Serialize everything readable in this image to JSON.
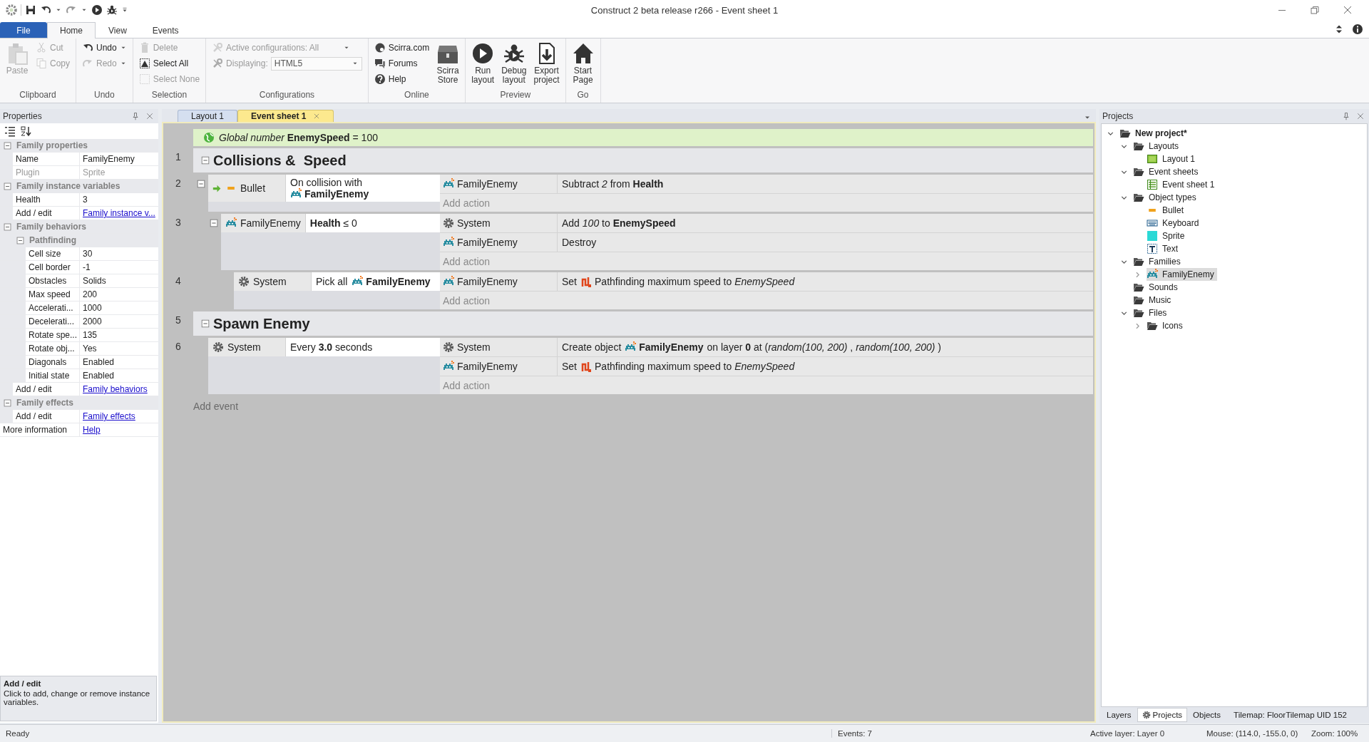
{
  "window": {
    "title": "Construct 2 beta release r266 - Event sheet 1"
  },
  "ribbon": {
    "tabs": [
      {
        "label": "File",
        "kind": "file",
        "selected": false
      },
      {
        "label": "Home",
        "kind": "tab",
        "selected": true
      },
      {
        "label": "View",
        "kind": "tab",
        "selected": false
      },
      {
        "label": "Events",
        "kind": "tab",
        "selected": false
      }
    ],
    "groups": [
      {
        "label": "Clipboard",
        "buttons": [
          {
            "label": "Paste",
            "kind": "large",
            "disabled": true
          },
          {
            "label": "Cut",
            "kind": "small",
            "disabled": true
          },
          {
            "label": "Copy",
            "kind": "small",
            "disabled": true
          }
        ]
      },
      {
        "label": "Undo",
        "buttons": [
          {
            "label": "Undo",
            "kind": "split",
            "disabled": false
          },
          {
            "label": "Redo",
            "kind": "split",
            "disabled": true
          }
        ]
      },
      {
        "label": "Selection",
        "buttons": [
          {
            "label": "Delete",
            "kind": "small",
            "disabled": true
          },
          {
            "label": "Select All",
            "kind": "small",
            "disabled": false
          },
          {
            "label": "Select None",
            "kind": "small",
            "disabled": true
          }
        ]
      },
      {
        "label": "Configurations",
        "buttons": [
          {
            "label": "Active configurations: All",
            "kind": "dropdown",
            "disabled": true
          },
          {
            "label": "Displaying:",
            "kind": "select",
            "value": "HTML5",
            "disabled": true
          }
        ]
      },
      {
        "label": "Online",
        "buttons": [
          {
            "label": "Scirra.com",
            "kind": "small",
            "disabled": false
          },
          {
            "label": "Forums",
            "kind": "small",
            "disabled": false
          },
          {
            "label": "Help",
            "kind": "small",
            "disabled": false
          },
          {
            "label": "Scirra Store",
            "kind": "large",
            "disabled": false
          }
        ]
      },
      {
        "label": "Preview",
        "buttons": [
          {
            "label": "Run layout",
            "kind": "large",
            "disabled": false
          },
          {
            "label": "Debug layout",
            "kind": "large",
            "disabled": false
          },
          {
            "label": "Export project",
            "kind": "large",
            "disabled": false
          }
        ]
      },
      {
        "label": "Go",
        "buttons": [
          {
            "label": "Start Page",
            "kind": "large",
            "disabled": false
          }
        ]
      }
    ]
  },
  "properties_panel": {
    "title": "Properties",
    "rows": [
      {
        "kind": "category",
        "label": "Family properties",
        "expanded": true,
        "children": [
          {
            "kind": "property",
            "name": "Name",
            "value": "FamilyEnemy",
            "disabled": false
          },
          {
            "kind": "property",
            "name": "Plugin",
            "value": "Sprite",
            "disabled": true
          }
        ]
      },
      {
        "kind": "category",
        "label": "Family instance variables",
        "expanded": true,
        "children": [
          {
            "kind": "property",
            "name": "Health",
            "value": "3",
            "disabled": false
          },
          {
            "kind": "link",
            "name": "Add / edit",
            "value": "Family instance v...",
            "disabled": false
          }
        ]
      },
      {
        "kind": "category",
        "label": "Family behaviors",
        "expanded": true,
        "children": [
          {
            "kind": "category",
            "label": "Pathfinding",
            "expanded": true,
            "children": [
              {
                "kind": "property",
                "name": "Cell size",
                "value": "30",
                "disabled": false
              },
              {
                "kind": "property",
                "name": "Cell border",
                "value": "-1",
                "disabled": false
              },
              {
                "kind": "property",
                "name": "Obstacles",
                "value": "Solids",
                "disabled": false
              },
              {
                "kind": "property",
                "name": "Max speed",
                "value": "200",
                "disabled": false
              },
              {
                "kind": "property",
                "name": "Accelerati...",
                "value": "1000",
                "disabled": false
              },
              {
                "kind": "property",
                "name": "Decelerati...",
                "value": "2000",
                "disabled": false
              },
              {
                "kind": "property",
                "name": "Rotate spe...",
                "value": "135",
                "disabled": false
              },
              {
                "kind": "property",
                "name": "Rotate obj...",
                "value": "Yes",
                "disabled": false
              },
              {
                "kind": "property",
                "name": "Diagonals",
                "value": "Enabled",
                "disabled": false
              },
              {
                "kind": "property",
                "name": "Initial state",
                "value": "Enabled",
                "disabled": false
              }
            ]
          },
          {
            "kind": "link",
            "name": "Add / edit",
            "value": "Family behaviors",
            "disabled": false
          }
        ]
      },
      {
        "kind": "category",
        "label": "Family effects",
        "expanded": true,
        "children": [
          {
            "kind": "link",
            "name": "Add / edit",
            "value": "Family effects",
            "disabled": false
          }
        ]
      },
      {
        "kind": "link",
        "name": "More information",
        "value": "Help",
        "disabled": false
      }
    ],
    "description": {
      "title": "Add / edit",
      "text": "Click to add, change or remove instance variables."
    }
  },
  "editor": {
    "tabs": [
      {
        "label": "Layout 1",
        "selected": false
      },
      {
        "label": "Event sheet 1",
        "selected": true
      }
    ],
    "global_variable": "*Global number* **EnemySpeed** = 100",
    "groups": [
      {
        "number": "1",
        "title": "Collisions &  Speed",
        "expanded": true,
        "events": [
          {
            "number": "2",
            "expanded": true,
            "conditions": [
              {
                "object": "Bullet",
                "kind": "sprite",
                "trigger": true,
                "parts": [
                  {
                    "kind": "text",
                    "text": "On collision with"
                  },
                  {
                    "kind": "object",
                    "text": "FamilyEnemy"
                  }
                ]
              }
            ],
            "actions": [
              {
                "object": "FamilyEnemy",
                "kind": "family",
                "parts": [
                  {
                    "kind": "text",
                    "text": "Subtract *2* from **Health**"
                  }
                ]
              }
            ],
            "add_action": "Add action",
            "children": [
              {
                "number": "3",
                "expanded": true,
                "conditions": [
                  {
                    "object": "FamilyEnemy",
                    "kind": "family",
                    "trigger": false,
                    "parts": [
                      {
                        "kind": "text",
                        "text": "**Health** ≤ 0"
                      }
                    ]
                  }
                ],
                "actions": [
                  {
                    "object": "System",
                    "kind": "system",
                    "parts": [
                      {
                        "kind": "text",
                        "text": "Add *100* to **EnemySpeed**"
                      }
                    ]
                  },
                  {
                    "object": "FamilyEnemy",
                    "kind": "family",
                    "parts": [
                      {
                        "kind": "text",
                        "text": "Destroy"
                      }
                    ]
                  }
                ],
                "add_action": "Add action",
                "children": [
                  {
                    "number": "4",
                    "conditions": [
                      {
                        "object": "System",
                        "kind": "system",
                        "trigger": false,
                        "parts": [
                          {
                            "kind": "text",
                            "text": "Pick all"
                          },
                          {
                            "kind": "object",
                            "text": "FamilyEnemy"
                          }
                        ]
                      }
                    ],
                    "actions": [
                      {
                        "object": "FamilyEnemy",
                        "kind": "family",
                        "parts": [
                          {
                            "kind": "text",
                            "text": "Set"
                          },
                          {
                            "kind": "behavior",
                            "text": "Pathfinding maximum speed to *EnemySpeed*"
                          }
                        ]
                      }
                    ],
                    "add_action": "Add action"
                  }
                ]
              }
            ]
          }
        ]
      },
      {
        "number": "5",
        "title": "Spawn Enemy",
        "expanded": true,
        "events": [
          {
            "number": "6",
            "conditions": [
              {
                "object": "System",
                "kind": "system",
                "trigger": false,
                "parts": [
                  {
                    "kind": "text",
                    "text": "Every **3.0** seconds"
                  }
                ]
              }
            ],
            "actions": [
              {
                "object": "System",
                "kind": "system",
                "parts": [
                  {
                    "kind": "text",
                    "text": "Create object"
                  },
                  {
                    "kind": "object",
                    "text": "FamilyEnemy"
                  },
                  {
                    "kind": "text",
                    "text": "on layer **0** at (*random(100, 200)* , *random(100, 200)* )"
                  }
                ]
              },
              {
                "object": "FamilyEnemy",
                "kind": "family",
                "parts": [
                  {
                    "kind": "text",
                    "text": "Set"
                  },
                  {
                    "kind": "behavior",
                    "text": "Pathfinding maximum speed to *EnemySpeed*"
                  }
                ]
              }
            ],
            "add_action": "Add action"
          }
        ]
      }
    ],
    "add_event": "Add event"
  },
  "projects_panel": {
    "title": "Projects",
    "tree": [
      {
        "label": "New project*",
        "kind": "folder",
        "expanded": true,
        "selected": false,
        "children": [
          {
            "label": "Layouts",
            "kind": "folder",
            "expanded": true,
            "selected": false,
            "children": [
              {
                "label": "Layout 1",
                "kind": "layout",
                "selected": false
              }
            ]
          },
          {
            "label": "Event sheets",
            "kind": "folder",
            "expanded": true,
            "selected": false,
            "children": [
              {
                "label": "Event sheet 1",
                "kind": "sheet",
                "selected": false
              }
            ]
          },
          {
            "label": "Object types",
            "kind": "folder",
            "expanded": true,
            "selected": false,
            "children": [
              {
                "label": "Bullet",
                "kind": "bullet",
                "selected": false
              },
              {
                "label": "Keyboard",
                "kind": "keyboard",
                "selected": false
              },
              {
                "label": "Sprite",
                "kind": "sprite",
                "selected": false
              },
              {
                "label": "Text",
                "kind": "text",
                "selected": false
              }
            ]
          },
          {
            "label": "Families",
            "kind": "folder",
            "expanded": true,
            "selected": false,
            "children": [
              {
                "label": "FamilyEnemy",
                "kind": "family",
                "expanded": false,
                "selected": true
              }
            ]
          },
          {
            "label": "Sounds",
            "kind": "folder",
            "selected": false
          },
          {
            "label": "Music",
            "kind": "folder",
            "selected": false
          },
          {
            "label": "Files",
            "kind": "folder",
            "expanded": true,
            "selected": false,
            "children": [
              {
                "label": "Icons",
                "kind": "folder",
                "expanded": false,
                "selected": false
              }
            ]
          }
        ]
      }
    ],
    "tabs": [
      {
        "label": "Layers",
        "selected": false
      },
      {
        "label": "Projects",
        "selected": true
      },
      {
        "label": "Objects",
        "selected": false
      }
    ],
    "info": "Tilemap: FloorTilemap UID 152"
  },
  "status_bar": {
    "message": "Ready",
    "events": "Events: 7",
    "layer": "Active layer: Layer 0",
    "mouse": "Mouse: (114.0, -155.0, 0)",
    "zoom": "Zoom: 100%"
  }
}
